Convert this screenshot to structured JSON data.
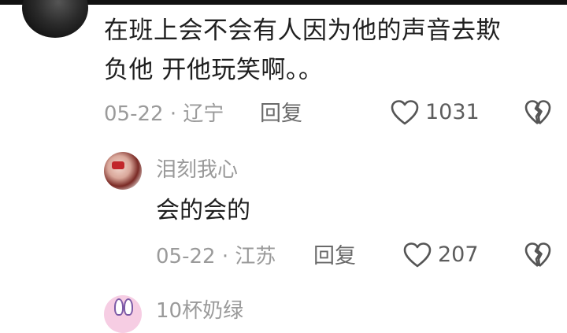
{
  "comment": {
    "text_line1": "在班上会不会有人因为他的声音去欺",
    "text_line2": "负他 开他玩笑啊。。",
    "meta": "05-22 · 辽宁",
    "reply_label": "回复",
    "likes": "1031"
  },
  "reply": {
    "username": "泪刻我心",
    "text": "会的会的",
    "meta": "05-22 · 江苏",
    "reply_label": "回复",
    "likes": "207"
  },
  "next_comment": {
    "username": "10杯奶绿"
  },
  "icons": {
    "like": "heart-outline-icon",
    "dislike": "broken-heart-icon"
  },
  "colors": {
    "text": "#1f1f1f",
    "meta": "#9a9a9a",
    "icon": "#555555"
  }
}
